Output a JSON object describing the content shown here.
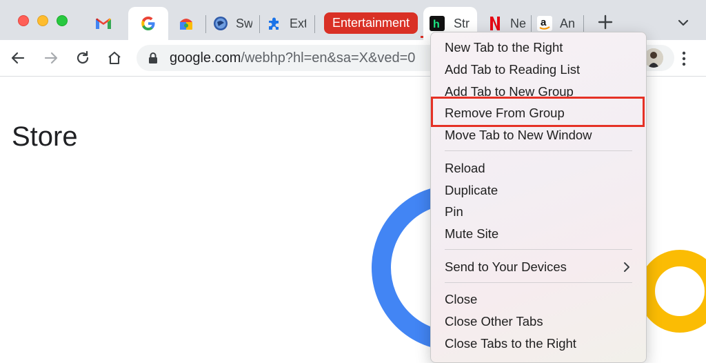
{
  "tabs": [
    {
      "title": "",
      "icon": "gmail-icon"
    },
    {
      "title": "",
      "icon": "google-icon",
      "active": true
    },
    {
      "title": "",
      "icon": "chrome-web-store-icon"
    },
    {
      "title": "Sw",
      "icon": "swift-icon"
    },
    {
      "title": "Ext",
      "icon": "extension-puzzle-icon"
    },
    {
      "title": "Str",
      "icon": "hulu-h-icon"
    },
    {
      "title": "Ne",
      "icon": "netflix-icon"
    },
    {
      "title": "An",
      "icon": "amazon-icon"
    }
  ],
  "tab_group": {
    "label": "Entertainment",
    "color": "#d93025"
  },
  "toolbar": {
    "url_host": "google.com",
    "url_path": "/webhp?hl=en&sa=X&ved=0"
  },
  "page": {
    "title": "Store"
  },
  "context_menu": {
    "items": [
      "New Tab to the Right",
      "Add Tab to Reading List",
      "Add Tab to New Group",
      "Remove From Group",
      "Move Tab to New Window",
      "Reload",
      "Duplicate",
      "Pin",
      "Mute Site",
      "Send to Your Devices",
      "Close",
      "Close Other Tabs",
      "Close Tabs to the Right"
    ],
    "highlighted": "Remove From Group",
    "highlight_color": "#e53125"
  }
}
